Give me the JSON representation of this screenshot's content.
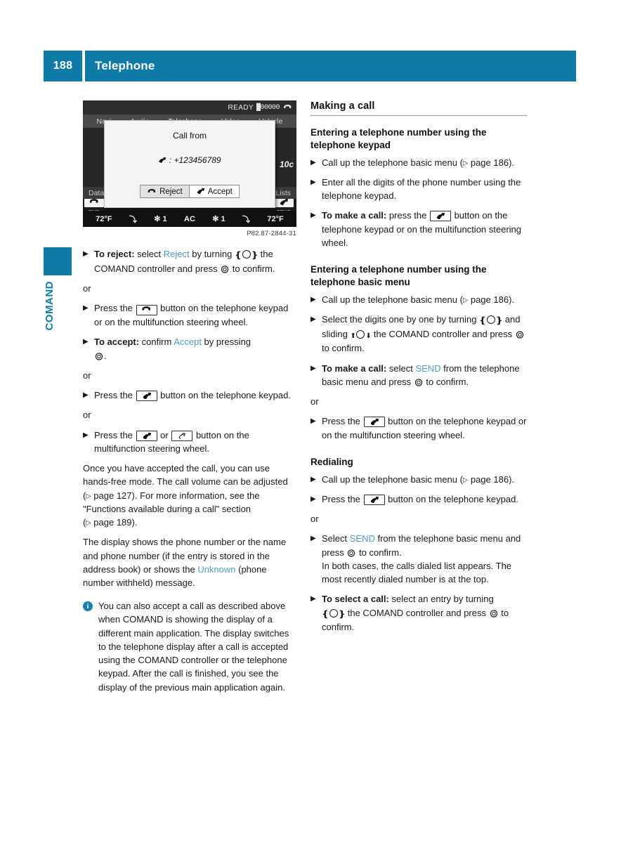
{
  "header": {
    "page_number": "188",
    "title": "Telephone"
  },
  "side_tab": {
    "label": "COMAND"
  },
  "figure": {
    "caption": "P82.87-2844-31",
    "screen": {
      "status": {
        "ready_text": "READY",
        "signal_bars": "█00000",
        "phone_icon": "handset-down-icon"
      },
      "menu_items": [
        "Navi",
        "Audio",
        "Telephone",
        "Video",
        "Vehicle"
      ],
      "left_key_label": "END",
      "right_key_label": "SEND",
      "counter": "10c",
      "row_labels": [
        "Data Connections",
        "Call Lists"
      ],
      "climate": [
        "72°F",
        "⤵",
        "✻ 1",
        "AC",
        "✻ 1",
        "⤵",
        "72°F"
      ],
      "dialog": {
        "title": "Call from",
        "number": ": +123456789",
        "reject_label": "Reject",
        "accept_label": "Accept"
      }
    }
  },
  "left_column": {
    "blocks": [
      {
        "type": "step",
        "parts": [
          {
            "t": "bold",
            "v": "To reject:"
          },
          {
            "t": "text",
            "v": " select "
          },
          {
            "t": "hl",
            "v": "Reject"
          },
          {
            "t": "text",
            "v": " by turning "
          },
          {
            "t": "ctrl-turn",
            "v": ""
          },
          {
            "t": "text",
            "v": " the COMAND controller and press "
          },
          {
            "t": "ctrl-press",
            "v": ""
          },
          {
            "t": "text",
            "v": " to confirm."
          }
        ]
      },
      {
        "type": "or",
        "v": "or"
      },
      {
        "type": "step",
        "parts": [
          {
            "t": "text",
            "v": "Press the "
          },
          {
            "t": "key-end",
            "v": ""
          },
          {
            "t": "text",
            "v": " button on the telephone keypad or on the multifunction steering wheel."
          }
        ]
      },
      {
        "type": "step",
        "parts": [
          {
            "t": "bold",
            "v": "To accept:"
          },
          {
            "t": "text",
            "v": " confirm "
          },
          {
            "t": "hl",
            "v": "Accept"
          },
          {
            "t": "text",
            "v": " by pressing "
          },
          {
            "t": "ctrl-press",
            "v": ""
          },
          {
            "t": "text",
            "v": "."
          }
        ]
      },
      {
        "type": "or",
        "v": "or"
      },
      {
        "type": "step",
        "parts": [
          {
            "t": "text",
            "v": "Press the "
          },
          {
            "t": "key-send",
            "v": ""
          },
          {
            "t": "text",
            "v": " button on the telephone keypad."
          }
        ]
      },
      {
        "type": "or",
        "v": "or"
      },
      {
        "type": "step",
        "parts": [
          {
            "t": "text",
            "v": "Press the "
          },
          {
            "t": "key-send",
            "v": ""
          },
          {
            "t": "text",
            "v": " or "
          },
          {
            "t": "key-mfsw",
            "v": ""
          },
          {
            "t": "text",
            "v": " button on the multifunction steering wheel."
          }
        ]
      }
    ],
    "para1_a": "Once you have accepted the call, you can use hands-free mode. The call volume can be adjusted (",
    "para1_pageref1": "page 127",
    "para1_b": "). For more information, see the \"Functions available during a call\" section (",
    "para1_pageref2": "page 189",
    "para1_c": ").",
    "para2_a": "The display shows the phone number or the name and phone number (if the entry is stored in the address book) or shows the ",
    "para2_hl": "Unknown",
    "para2_b": " (phone number withheld) message.",
    "note": "You can also accept a call as described above when COMAND is showing the display of a different main application. The display switches to the telephone display after a call is accepted using the COMAND controller or the telephone keypad. After the call is finished, you see the display of the previous main application again."
  },
  "right_column": {
    "section_title": "Making a call",
    "sub1_title": "Entering a telephone number using the telephone keypad",
    "sub1_step1_a": "Call up the telephone basic menu (",
    "sub1_step1_ref": "page 186",
    "sub1_step1_b": ").",
    "sub1_step2": "Enter all the digits of the phone number using the telephone keypad.",
    "sub1_step3_bold": "To make a call:",
    "sub1_step3_a": " press the ",
    "sub1_step3_b": " button on the telephone keypad or on the multifunction steering wheel.",
    "sub2_title": "Entering a telephone number using the telephone basic menu",
    "sub2_step1_a": "Call up the telephone basic menu (",
    "sub2_step1_ref": "page 186",
    "sub2_step1_b": ").",
    "sub2_step2_a": "Select the digits one by one by turning ",
    "sub2_step2_b": " and sliding ",
    "sub2_step2_c": " the COMAND controller and press ",
    "sub2_step2_d": " to confirm.",
    "sub2_step3_bold": "To make a call:",
    "sub2_step3_a": " select ",
    "sub2_step3_hl": "SEND",
    "sub2_step3_b": " from the telephone basic menu and press ",
    "sub2_step3_c": " to confirm.",
    "or1": "or",
    "sub2_step4_a": "Press the ",
    "sub2_step4_b": " button on the telephone keypad or on the multifunction steering wheel.",
    "sub3_title": "Redialing",
    "sub3_step1_a": "Call up the telephone basic menu (",
    "sub3_step1_ref": "page 186",
    "sub3_step1_b": ").",
    "sub3_step2_a": "Press the ",
    "sub3_step2_b": " button on the telephone keypad.",
    "or2": "or",
    "sub3_step3_a": "Select ",
    "sub3_step3_hl": "SEND",
    "sub3_step3_b": " from the telephone basic menu and press ",
    "sub3_step3_c": " to confirm.",
    "sub3_step3_extra": "In both cases, the calls dialed list appears. The most recently dialed number is at the top.",
    "sub3_step4_bold": "To select a call:",
    "sub3_step4_a": " select an entry by turning ",
    "sub3_step4_b": " the COMAND controller and press ",
    "sub3_step4_c": " to confirm."
  },
  "colors": {
    "brand_blue": "#0d7aa8",
    "highlight_blue": "#4d9cc4",
    "text": "#1a1a1a"
  }
}
